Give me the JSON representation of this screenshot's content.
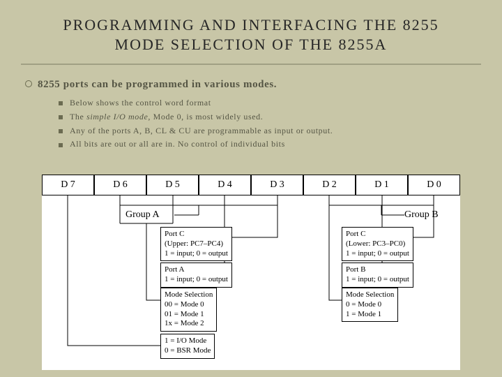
{
  "title_line1": "PROGRAMMING AND INTERFACING THE 8255",
  "title_line2": "MODE SELECTION OF THE 8255A",
  "main_bullet": "8255 ports can be programmed in various modes.",
  "subs": {
    "s1": "Below shows the control word format",
    "s2_pre": "The ",
    "s2_em": "simple I/O mode",
    "s2_post": ", Mode 0, is most widely used.",
    "s3": "Any of the ports A, B, CL & CU are programmable as input or output.",
    "s4": "All bits are out or all are in. No control of individual bits"
  },
  "bits": [
    "D 7",
    "D 6",
    "D 5",
    "D 4",
    "D 3",
    "D 2",
    "D 1",
    "D 0"
  ],
  "groupA": "Group A",
  "groupB": "Group B",
  "boxes": {
    "pcUpper_t": "Port C",
    "pcUpper_sub": "(Upper: PC7–PC4)",
    "pcUpper_io": "1 = input; 0 = output",
    "portA_t": "Port A",
    "portA_io": "1 = input; 0 = output",
    "modeA_t": "Mode Selection",
    "modeA_1": "00 = Mode 0",
    "modeA_2": "01 = Mode 1",
    "modeA_3": "1x = Mode 2",
    "d7_1": "1 = I/O Mode",
    "d7_0": "0 = BSR Mode",
    "pcLower_t": "Port C",
    "pcLower_sub": "(Lower: PC3–PC0)",
    "pcLower_io": "1 = input; 0 = output",
    "portB_t": "Port B",
    "portB_io": "1 = input; 0 = output",
    "modeB_t": "Mode Selection",
    "modeB_1": "0 = Mode 0",
    "modeB_2": "1 = Mode 1"
  }
}
